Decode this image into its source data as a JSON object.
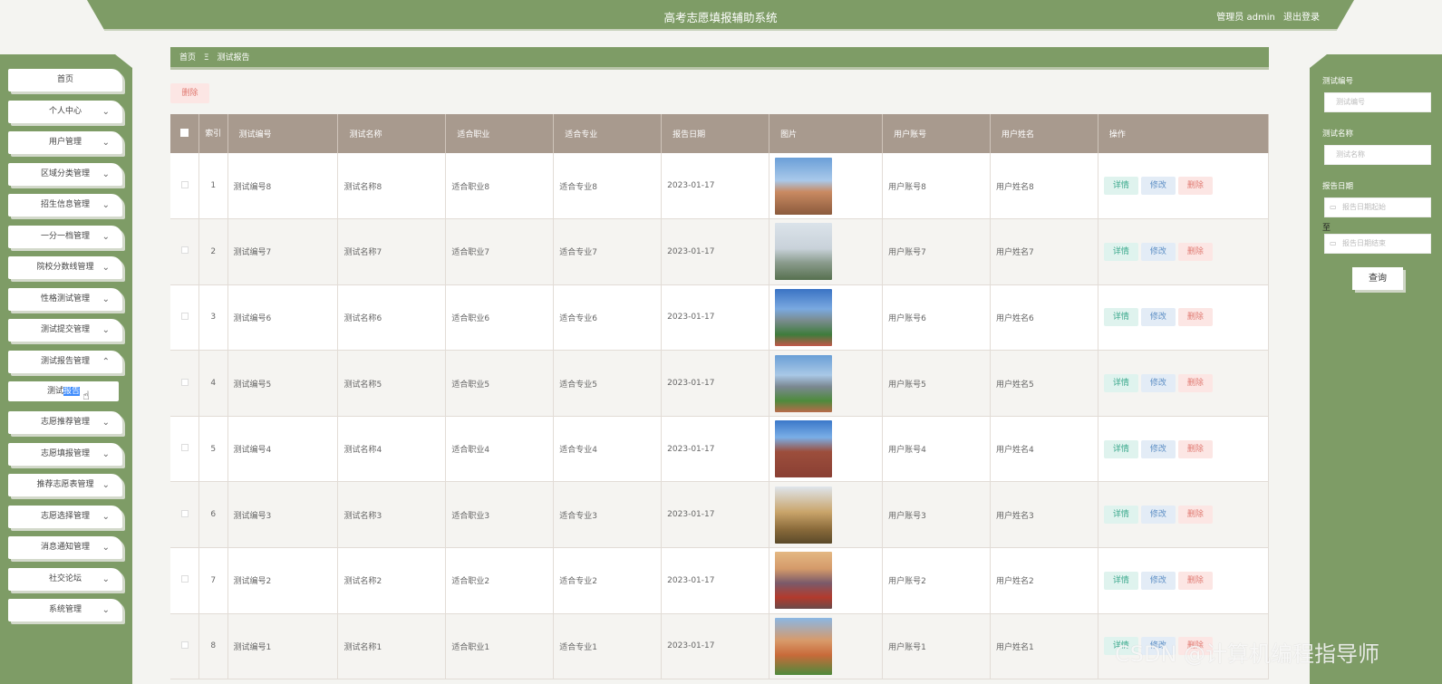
{
  "header": {
    "title": "高考志愿填报辅助系统",
    "user": "管理员 admin",
    "logout": "退出登录"
  },
  "sidebar": {
    "items": [
      {
        "label": "首页",
        "has_chevron": false
      },
      {
        "label": "个人中心",
        "has_chevron": true
      },
      {
        "label": "用户管理",
        "has_chevron": true
      },
      {
        "label": "区域分类管理",
        "has_chevron": true
      },
      {
        "label": "招生信息管理",
        "has_chevron": true
      },
      {
        "label": "一分一档管理",
        "has_chevron": true
      },
      {
        "label": "院校分数线管理",
        "has_chevron": true
      },
      {
        "label": "性格测试管理",
        "has_chevron": true
      },
      {
        "label": "测试提交管理",
        "has_chevron": true
      },
      {
        "label": "测试报告管理",
        "has_chevron": true,
        "expanded": true
      },
      {
        "label": "志愿推荐管理",
        "has_chevron": true
      },
      {
        "label": "志愿填报管理",
        "has_chevron": true
      },
      {
        "label": "推荐志愿表管理",
        "has_chevron": true
      },
      {
        "label": "志愿选择管理",
        "has_chevron": true
      },
      {
        "label": "消息通知管理",
        "has_chevron": true
      },
      {
        "label": "社交论坛",
        "has_chevron": true
      },
      {
        "label": "系统管理",
        "has_chevron": true
      }
    ],
    "submenu": {
      "label_a": "测试",
      "label_b": "报告"
    }
  },
  "breadcrumb": {
    "home": "首页",
    "separator": "Ξ",
    "current": "测试报告"
  },
  "toolbar": {
    "delete_label": "删除"
  },
  "table": {
    "headers": [
      "索引",
      "测试编号",
      "测试名称",
      "适合职业",
      "适合专业",
      "报告日期",
      "图片",
      "用户账号",
      "用户姓名",
      "操作"
    ],
    "rows": [
      {
        "idx": "1",
        "code": "测试编号8",
        "name": "测试名称8",
        "job": "适合职业8",
        "major": "适合专业8",
        "date": "2023-01-17",
        "account": "用户账号8",
        "username": "用户姓名8"
      },
      {
        "idx": "2",
        "code": "测试编号7",
        "name": "测试名称7",
        "job": "适合职业7",
        "major": "适合专业7",
        "date": "2023-01-17",
        "account": "用户账号7",
        "username": "用户姓名7"
      },
      {
        "idx": "3",
        "code": "测试编号6",
        "name": "测试名称6",
        "job": "适合职业6",
        "major": "适合专业6",
        "date": "2023-01-17",
        "account": "用户账号6",
        "username": "用户姓名6"
      },
      {
        "idx": "4",
        "code": "测试编号5",
        "name": "测试名称5",
        "job": "适合职业5",
        "major": "适合专业5",
        "date": "2023-01-17",
        "account": "用户账号5",
        "username": "用户姓名5"
      },
      {
        "idx": "5",
        "code": "测试编号4",
        "name": "测试名称4",
        "job": "适合职业4",
        "major": "适合专业4",
        "date": "2023-01-17",
        "account": "用户账号4",
        "username": "用户姓名4"
      },
      {
        "idx": "6",
        "code": "测试编号3",
        "name": "测试名称3",
        "job": "适合职业3",
        "major": "适合专业3",
        "date": "2023-01-17",
        "account": "用户账号3",
        "username": "用户姓名3"
      },
      {
        "idx": "7",
        "code": "测试编号2",
        "name": "测试名称2",
        "job": "适合职业2",
        "major": "适合专业2",
        "date": "2023-01-17",
        "account": "用户账号2",
        "username": "用户姓名2"
      },
      {
        "idx": "8",
        "code": "测试编号1",
        "name": "测试名称1",
        "job": "适合职业1",
        "major": "适合专业1",
        "date": "2023-01-17",
        "account": "用户账号1",
        "username": "用户姓名1"
      }
    ],
    "actions": {
      "detail": "详情",
      "edit": "修改",
      "delete": "删除"
    }
  },
  "search": {
    "code_label": "测试编号",
    "code_placeholder": "测试编号",
    "name_label": "测试名称",
    "name_placeholder": "测试名称",
    "date_label": "报告日期",
    "date_start_placeholder": "报告日期起始",
    "date_to": "至",
    "date_end_placeholder": "报告日期结束",
    "query_label": "查询"
  },
  "watermark": "CSDN @计算机编程指导师",
  "colors": {
    "accent_green": "#7e9c66",
    "table_header": "#a89a8e",
    "delete_red": "#e07a72",
    "detail_teal": "#3ba88c",
    "edit_blue": "#5d8fc5"
  }
}
